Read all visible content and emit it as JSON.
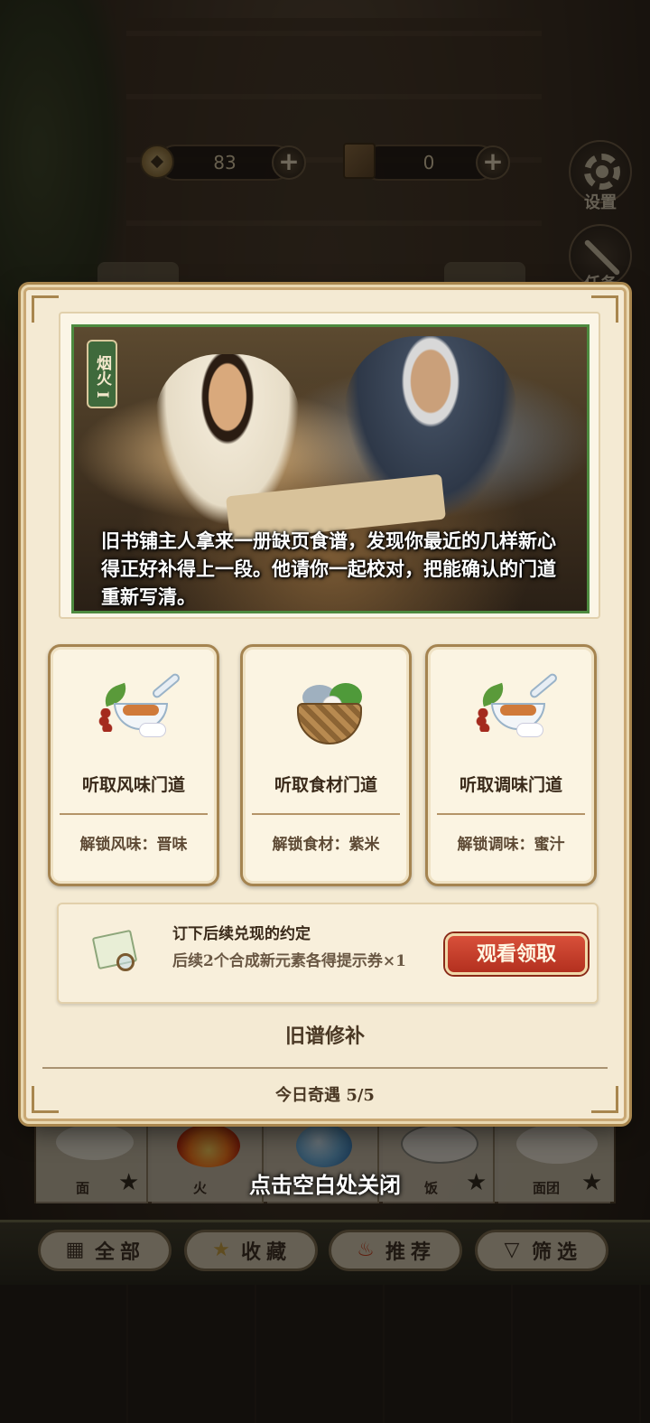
{
  "hud": {
    "coins": "83",
    "tickets": "0",
    "plus_symbol": "+",
    "settings_label": "设置",
    "tasks_label": "任务"
  },
  "modal": {
    "story": {
      "tag": "烟火 I",
      "text": "旧书铺主人拿来一册缺页食谱，发现你最近的几样新心得正好补得上一段。他请你一起校对，把能确认的门道重新写清。"
    },
    "options": [
      {
        "title": "听取风味门道",
        "unlock": "解锁风味：晋味",
        "icon": "spoon-soup-icon"
      },
      {
        "title": "听取食材门道",
        "unlock": "解锁食材：紫米",
        "icon": "ingredient-basket-icon"
      },
      {
        "title": "听取调味门道",
        "unlock": "解锁调味：蜜汁",
        "icon": "spoon-soup-icon"
      }
    ],
    "pact": {
      "title": "订下后续兑现的约定",
      "description": "后续2个合成新元素各得提示券×1",
      "button": "观看领取",
      "icon": "scroll-magnifier-icon"
    },
    "section_title": "旧谱修补",
    "daily_encounter": "今日奇遇 5/5"
  },
  "close_hint": "点击空白处关闭",
  "inventory": {
    "items": [
      {
        "label": "面"
      },
      {
        "label": "火"
      },
      {
        "label": ""
      },
      {
        "label": "饭"
      },
      {
        "label": "面团"
      }
    ],
    "star_symbol": "★"
  },
  "filters": [
    {
      "label": "全部",
      "icon": "grid-icon"
    },
    {
      "label": "收藏",
      "icon": "star-icon"
    },
    {
      "label": "推荐",
      "icon": "fire-icon"
    },
    {
      "label": "筛选",
      "icon": "funnel-icon"
    }
  ],
  "colors": {
    "modal_bg": "#f4ead3",
    "accent_red": "#b3301f",
    "frame_green": "#4d8a3f",
    "text_dark": "#3a2a1a"
  }
}
